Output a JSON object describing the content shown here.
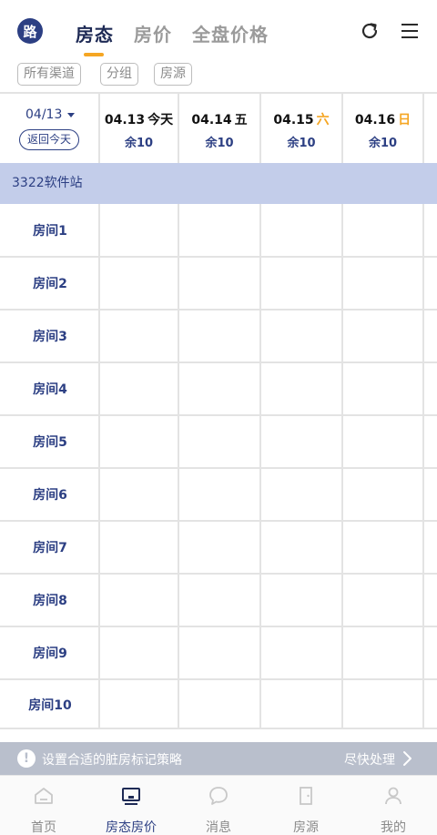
{
  "header": {
    "logo_char": "路",
    "tabs": [
      {
        "label": "房态",
        "active": true
      },
      {
        "label": "房价",
        "active": false
      },
      {
        "label": "全盘价格",
        "active": false
      }
    ],
    "accent_color": "#f5a623",
    "brand_color": "#2c3f83",
    "icons": [
      "refresh-icon",
      "menu-icon"
    ]
  },
  "filters": [
    {
      "label": "所有渠道"
    },
    {
      "label": "分组"
    },
    {
      "label": "房源"
    }
  ],
  "calendar": {
    "selected_date": "04/13",
    "today_button": "返回今天",
    "days": [
      {
        "date": "04.13",
        "weekday": "今天",
        "weekend": false,
        "avail": "余10"
      },
      {
        "date": "04.14",
        "weekday": "五",
        "weekend": false,
        "avail": "余10"
      },
      {
        "date": "04.15",
        "weekday": "六",
        "weekend": true,
        "avail": "余10"
      },
      {
        "date": "04.16",
        "weekday": "日",
        "weekend": true,
        "avail": "余10"
      }
    ]
  },
  "channel": {
    "name": "3322软件站"
  },
  "rooms": [
    {
      "name": "房间1"
    },
    {
      "name": "房间2"
    },
    {
      "name": "房间3"
    },
    {
      "name": "房间4"
    },
    {
      "name": "房间5"
    },
    {
      "name": "房间6"
    },
    {
      "name": "房间7"
    },
    {
      "name": "房间8"
    },
    {
      "name": "房间9"
    },
    {
      "name": "房间10"
    }
  ],
  "banner": {
    "text": "设置合适的脏房标记策略",
    "action": "尽快处理"
  },
  "bottom_nav": [
    {
      "label": "首页",
      "icon": "home-icon",
      "active": false
    },
    {
      "label": "房态房价",
      "icon": "monitor-icon",
      "active": true
    },
    {
      "label": "消息",
      "icon": "chat-icon",
      "active": false
    },
    {
      "label": "房源",
      "icon": "door-icon",
      "active": false
    },
    {
      "label": "我的",
      "icon": "user-icon",
      "active": false
    }
  ]
}
